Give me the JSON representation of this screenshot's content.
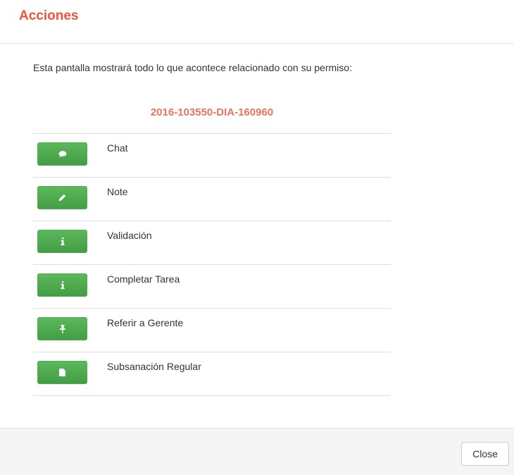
{
  "colors": {
    "title": "#f0533a",
    "permit_code": "#e6745e",
    "button_green": "#5cb85c"
  },
  "modal": {
    "title": "Acciones",
    "intro": "Esta pantalla mostrará todo lo que acontece relacionado con su permiso:",
    "permit_code": "2016-103550-DIA-160960",
    "actions": [
      {
        "label": "Chat",
        "icon": "comment-icon"
      },
      {
        "label": "Note",
        "icon": "pencil-icon"
      },
      {
        "label": "Validación",
        "icon": "info-icon"
      },
      {
        "label": "Completar Tarea",
        "icon": "info-icon"
      },
      {
        "label": "Referir a Gerente",
        "icon": "pushpin-icon"
      },
      {
        "label": "Subsanación Regular",
        "icon": "file-icon"
      }
    ],
    "close_label": "Close"
  }
}
